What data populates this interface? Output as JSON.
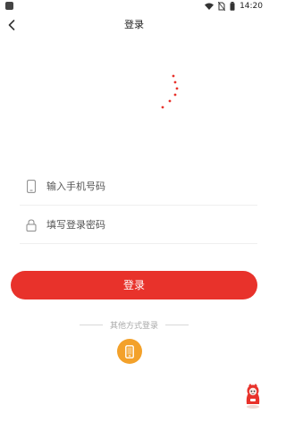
{
  "status_bar": {
    "time": "14:20",
    "icons": [
      "app-notification-icon",
      "wifi-icon",
      "no-sim-icon",
      "battery-icon"
    ]
  },
  "nav": {
    "title": "登录",
    "back_icon": "chevron-left-icon"
  },
  "logo": {
    "icon": "brand-logo",
    "colors": {
      "blue": "#1f3a8a",
      "red": "#e8322b"
    }
  },
  "form": {
    "phone": {
      "placeholder": "输入手机号码",
      "value": "",
      "icon": "phone-icon"
    },
    "password": {
      "placeholder": "填写登录密码",
      "value": "",
      "icon": "lock-icon"
    }
  },
  "login_button": {
    "label": "登录",
    "color": "#e8322b"
  },
  "other_login": {
    "label": "其他方式登录",
    "methods": [
      {
        "icon": "phone-icon",
        "color": "#f3a12a"
      }
    ]
  },
  "floating_helper": {
    "icon": "mascot-icon"
  }
}
